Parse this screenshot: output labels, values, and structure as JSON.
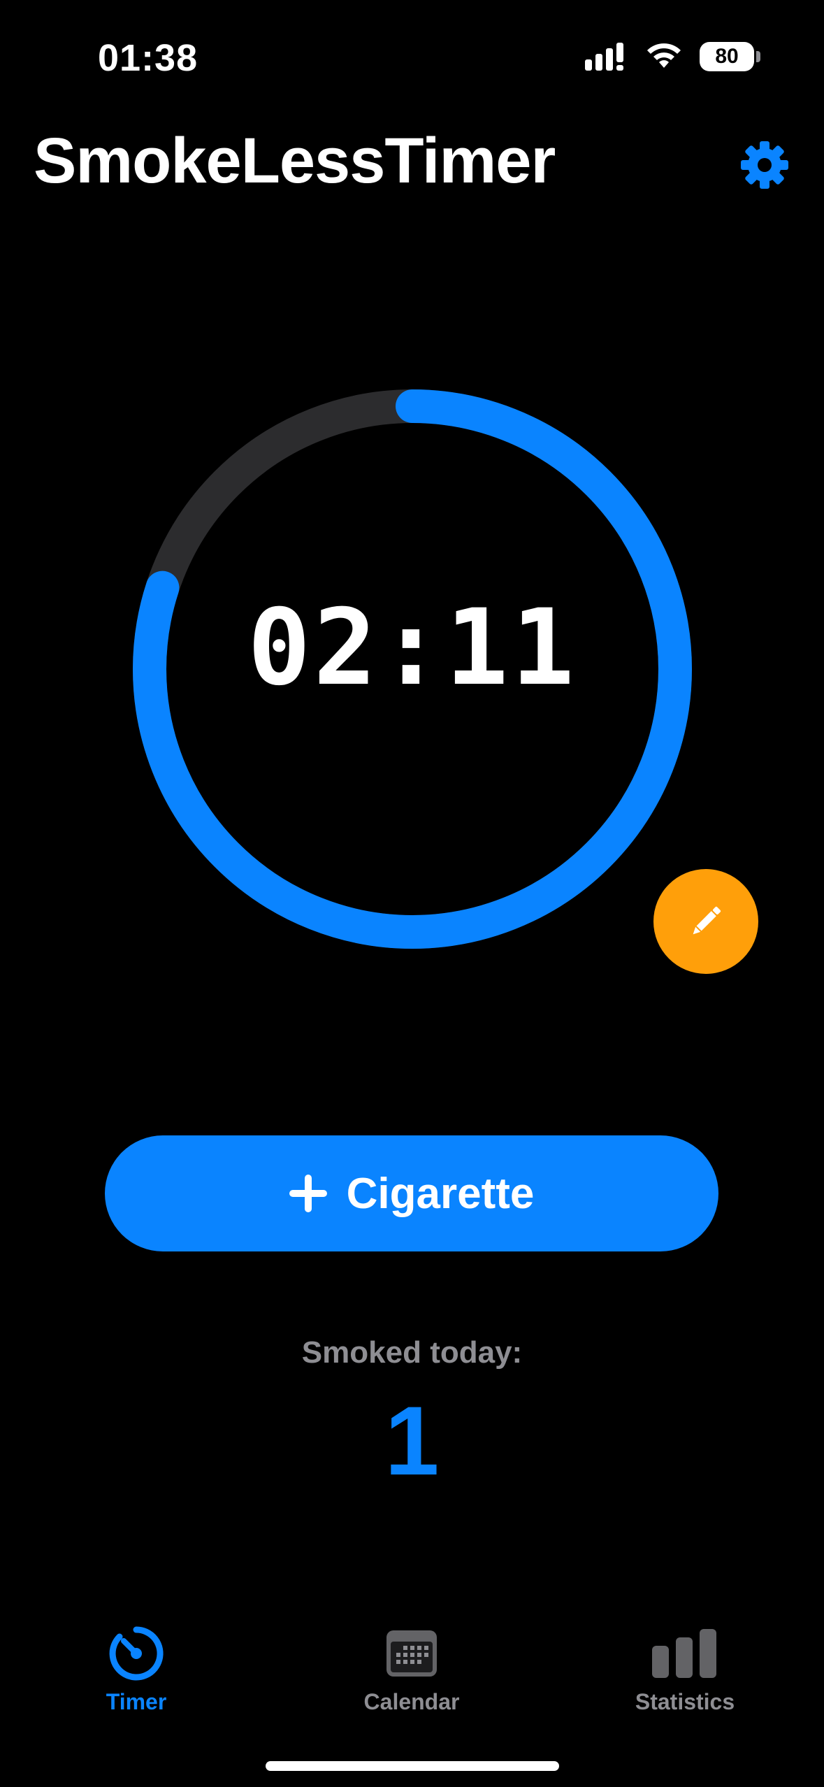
{
  "status_bar": {
    "time": "01:38",
    "battery": "80"
  },
  "header": {
    "title": "SmokeLessTimer",
    "settings_icon": "gear-icon"
  },
  "timer": {
    "display": "02:11",
    "progress": 0.8
  },
  "edit": {
    "icon": "pencil-icon"
  },
  "add_button": {
    "label": "Cigarette",
    "icon": "plus-icon"
  },
  "summary": {
    "label": "Smoked today:",
    "count": "1"
  },
  "tabs": [
    {
      "label": "Timer",
      "icon": "timer-icon",
      "active": true
    },
    {
      "label": "Calendar",
      "icon": "calendar-icon",
      "active": false
    },
    {
      "label": "Statistics",
      "icon": "chart-bar-icon",
      "active": false
    }
  ],
  "colors": {
    "accent": "#0a84ff",
    "edit": "#ff9f0a",
    "track": "#2c2c2e",
    "muted": "#8e8e93"
  }
}
